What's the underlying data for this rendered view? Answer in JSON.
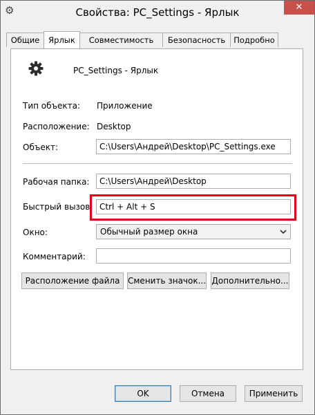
{
  "window": {
    "title": "Свойства: PC_Settings - Ярлык",
    "close_glyph": "✕",
    "icon": "gear-icon"
  },
  "tabs": [
    {
      "label": "Общие",
      "active": false
    },
    {
      "label": "Ярлык",
      "active": true
    },
    {
      "label": "Совместимость",
      "active": false
    },
    {
      "label": "Безопасность",
      "active": false
    },
    {
      "label": "Подробно",
      "active": false
    }
  ],
  "shortcut": {
    "name": "PC_Settings - Ярлык",
    "icon": "gear-icon",
    "type_label": "Тип объекта:",
    "type_value": "Приложение",
    "location_label": "Расположение:",
    "location_value": "Desktop",
    "target_label": "Объект:",
    "target_value": "C:\\Users\\Андрей\\Desktop\\PC_Settings.exe",
    "start_in_label": "Рабочая папка:",
    "start_in_value": "C:\\Users\\Андрей\\Desktop",
    "hotkey_label": "Быстрый вызов:",
    "hotkey_value": "Ctrl + Alt + S",
    "run_label": "Окно:",
    "run_value": "Обычный размер окна",
    "comment_label": "Комментарий:",
    "comment_value": ""
  },
  "buttons": {
    "open_location": "Расположение файла",
    "change_icon": "Сменить значок...",
    "advanced": "Дополнительно...",
    "ok": "OK",
    "cancel": "Отмена",
    "apply": "Применить"
  },
  "colors": {
    "highlight": "#e3001b",
    "close_button": "#c7504b"
  }
}
